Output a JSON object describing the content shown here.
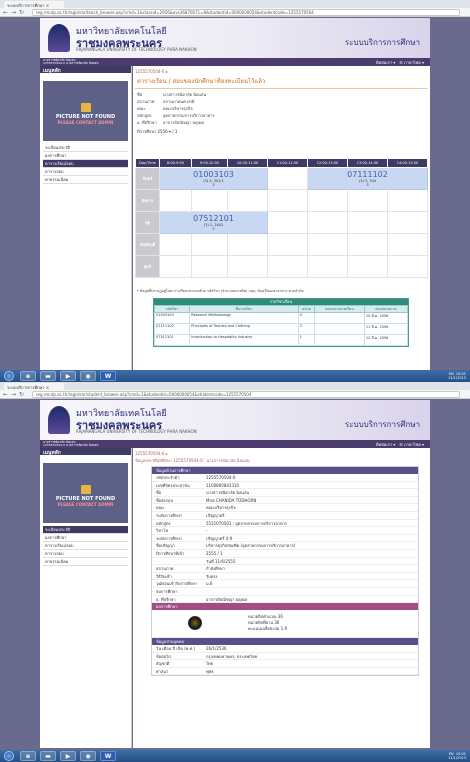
{
  "browser": {
    "tab_title": "ระบบบริการการศึกษา",
    "url_1": "reg.rmutp.ac.th/registrar/teach_browse.asp?cmd=1&classid=2956&avs36870071=8&studentid=0000000054&studentcode=1255570504",
    "url_2": "reg.rmutp.ac.th/registrar/student_browse.asp?cmd=1&studentid=0000000054&studentcode=1255570504",
    "status_url": "reg.rmutp.ac.th/registrar/teach_browse.asp?cmd=1&classid=29566"
  },
  "header": {
    "uni_name_th_1": "มหาวิทยาลัยเทคโนโลยี",
    "uni_name_th_2": "ราชมงคลพระนคร",
    "uni_name_en": "RAJAMANGALA UNIVERSITY OF TECHNOLOGY PHRA NAKHON",
    "system_title": "ระบบบริการการศึกษา",
    "user_line1": "นางสาวชนิดาลัย นิลแสน",
    "user_line2": "1255570504-0 นางสาวชนิดาลัย นิลแสน",
    "menu_label": "ติดต่อเรา ▾",
    "lang_label": "☰ ภาษาไทย ▾"
  },
  "sidebar": {
    "title": "เมนูหลัก",
    "photo_title": "PICTURE NOT FOUND",
    "photo_sub": "PLEASE CONTACT ADMIN",
    "items_1": [
      "ระเบียนประวัติ",
      "ผลการศึกษา",
      "ตารางเรียน/สอบ",
      "ตารางสอบ",
      "ค่าธรรมเนียม"
    ],
    "items_2": [
      "ระเบียนประวัติ",
      "ผลการศึกษา",
      "ตารางเรียน/สอบ",
      "ตารางสอบ",
      "ค่าธรรมเนียม"
    ]
  },
  "schedule_page": {
    "breadcrumb": "1255570504-0 ▸",
    "title": "ตารางเรียน / สอบของนักศึกษาที่ลงทะเบียนไว้แล้ว",
    "info": [
      {
        "k": "ชื่อ",
        "v": "นางสาวชนิดาลัย นิลแสน"
      },
      {
        "k": "สถานภาพ",
        "v": "สถานภาพนศ.ปกติ"
      },
      {
        "k": "คณะ",
        "v": "คณะบริหารธุรกิจ"
      },
      {
        "k": "หลักสูตร",
        "v": "อุตสาหกรรมการบริการอาหาร"
      },
      {
        "k": "อ. ที่ปรึกษา",
        "v": "อาจารย์ปณิชญา ผดุงผล"
      }
    ],
    "term": "ปีการศึกษา 2556 ▾ / 1",
    "columns": [
      "Day/Time",
      "8:00-9:00",
      "9:00-10:00",
      "10:00-11:00",
      "11:00-12:00",
      "12:00-13:00",
      "13:00-14:00",
      "14:00-15:00"
    ],
    "days": [
      "จันทร์",
      "อังคาร",
      "พุธ",
      "พฤหัสบดี",
      "ศุกร์"
    ],
    "course_mon_a": {
      "code": "01003103",
      "meta": "(3) 4, 301/1",
      "room": "3"
    },
    "course_mon_b": {
      "code": "07111102",
      "meta": "(3) 3, 344",
      "room": "3"
    },
    "course_wed": {
      "code": "07512101",
      "meta": "(3) 1, 2402",
      "room": "3"
    },
    "note": "* ข้อมูลที่ปรากฏอยู่ในตารางเรียนประกอบด้วย รหัสวิชา (จำนวนหน่วยกิต) กลุ่ม, ห้องเรียนและอาคาร ตามลำดับ",
    "course_box_title": "รายวิชาเรียน",
    "course_cols": [
      "รหัสวิชา",
      "ชื่อรายวิชา",
      "หน่วย",
      "สอบกลางภาคเรียน",
      "สอบปลายภาค"
    ],
    "courses": [
      {
        "code": "01003103",
        "name": "Research Methodology",
        "credit": "4",
        "mid": "",
        "final": "10 มี.ค. 2556"
      },
      {
        "code": "07111102",
        "name": "Principles of Textiles and Clothing",
        "credit": "3",
        "mid": "",
        "final": "11 มี.ค. 2556"
      },
      {
        "code": "07512101",
        "name": "Introduction to Hospitality Industry",
        "credit": "1",
        "mid": "",
        "final": "12 มี.ค. 2556"
      }
    ]
  },
  "profile_page": {
    "breadcrumb": "1255570504-0 ▸",
    "title": "ข้อมูลประวัตินักศึกษา 1255570504-0 : นางสาวชนิดาลัย นิลแสน",
    "section_main": "ข้อมูลด้านการศึกษา",
    "rows_main": [
      {
        "k": "รหัสประจำตัว",
        "v": "1255570504-0"
      },
      {
        "k": "เลขที่บัตรประชาชน",
        "v": "1100800843310"
      },
      {
        "k": "ชื่อ",
        "v": "นางสาวชนิดาลัย นิลแสน"
      },
      {
        "k": "ชื่ออังกฤษ",
        "v": "Miss CHANIDA TODHORN"
      },
      {
        "k": "คณะ",
        "v": "คณะบริหารธุรกิจ"
      },
      {
        "k": "ระดับการศึกษา",
        "v": "ปริญญาตรี"
      },
      {
        "k": "หลักสูตร",
        "v": "5521070501 : อุตสาหกรรมการบริการอาหาร"
      },
      {
        "k": "วิชาโท",
        "v": "-"
      },
      {
        "k": "ระดับการศึกษา",
        "v": "ปริญญาตรี 4 ปี"
      },
      {
        "k": "ชื่อปริญญา",
        "v": "บริหารธุรกิจบัณฑิต (อุตสาหกรรมการบริการอาหาร)"
      },
      {
        "k": "ปีการศึกษาที่เข้า",
        "v": "2555 / 1"
      },
      {
        "k": "",
        "v": "วันที่ 11/6/2555"
      },
      {
        "k": "สถานภาพ",
        "v": "กำลังศึกษา"
      },
      {
        "k": "วิธีรับเข้า",
        "v": "รับตรง"
      },
      {
        "k": "วุฒิก่อนเข้ารับการศึกษา",
        "v": "ม.6"
      },
      {
        "k": "จบการศึกษา",
        "v": ""
      },
      {
        "k": "อ. ที่ปรึกษา",
        "v": "อาจารย์ปณิชญา ผดุงผล"
      }
    ],
    "section_gpa": "ผลการศึกษา",
    "gpa_lines": [
      "หน่วยกิตคำนวณ  36",
      "หน่วยกิตที่ผ่าน  36",
      "คะแนนเฉลี่ยสะสม  1.9"
    ],
    "section_personal": "ข้อมูลส่วนบุคคล",
    "rows_personal": [
      {
        "k": "วัน เดือน ปี เกิด (พ.ศ.)",
        "v": "26/1/2536"
      },
      {
        "k": "ข้อต่อไป",
        "v": "กรุงเทพมหานคร, ประเทศไทย"
      },
      {
        "k": "สัญชาติ",
        "v": "ไทย"
      },
      {
        "k": "ศาสนา",
        "v": "พุทธ"
      }
    ]
  },
  "taskbar": {
    "clock_1": "10:01",
    "date_1": "11/1/2013",
    "clock_2": "10:01",
    "date_2": "11/1/2013",
    "lang": "EN"
  }
}
